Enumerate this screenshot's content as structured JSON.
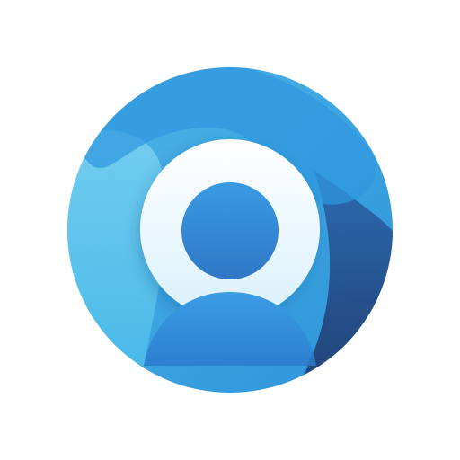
{
  "icon": {
    "semantic": "user-profile-app-icon",
    "colors": {
      "background": "#ffffff",
      "ring_light_top": "#4fb6e8",
      "ring_light_bottom": "#2b93d8",
      "ring_dark_top": "#2c6bb2",
      "ring_dark_bottom": "#1f3f72",
      "left_highlight_top": "#77cff0",
      "left_highlight_bottom": "#4bbcea",
      "halo_top": "#ffffff",
      "halo_bottom": "#d9f0fb",
      "head_top": "#3a9ae2",
      "head_bottom": "#2f77c6",
      "body_top": "#3b9de4",
      "body_bottom": "#2d7fd0"
    }
  }
}
